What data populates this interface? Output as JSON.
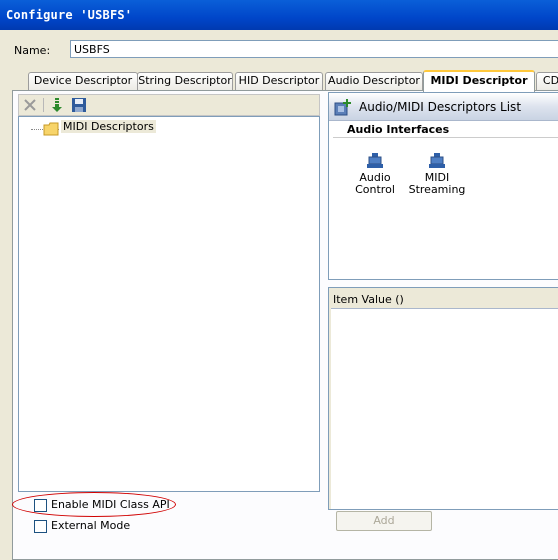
{
  "window": {
    "title": "Configure 'USBFS'"
  },
  "name_field": {
    "label": "Name:",
    "value": "USBFS"
  },
  "tabs": [
    {
      "label": "Device Descriptor"
    },
    {
      "label": "String Descriptor"
    },
    {
      "label": "HID Descriptor"
    },
    {
      "label": "Audio Descriptor"
    },
    {
      "label": "MIDI Descriptor"
    },
    {
      "label": "CD"
    }
  ],
  "toolbar": {
    "icons": [
      "delete-icon",
      "import-icon",
      "save-icon"
    ]
  },
  "tree": {
    "root": "MIDI Descriptors"
  },
  "descriptors_list": {
    "title": "Audio/MIDI Descriptors List",
    "section": "Audio Interfaces",
    "items": [
      {
        "line1": "Audio",
        "line2": "Control"
      },
      {
        "line1": "MIDI",
        "line2": "Streaming"
      }
    ]
  },
  "item_value": {
    "title": "Item Value ()"
  },
  "checkboxes": {
    "enable_midi_api": {
      "label": "Enable MIDI Class API",
      "checked": false
    },
    "external_mode": {
      "label": "External Mode",
      "checked": false
    }
  },
  "add_button": {
    "label": "Add",
    "enabled": false
  },
  "colors": {
    "titlebar": "#0046c9",
    "highlight_ellipse": "#d00000",
    "active_tab_accent": "#ffc83c"
  }
}
